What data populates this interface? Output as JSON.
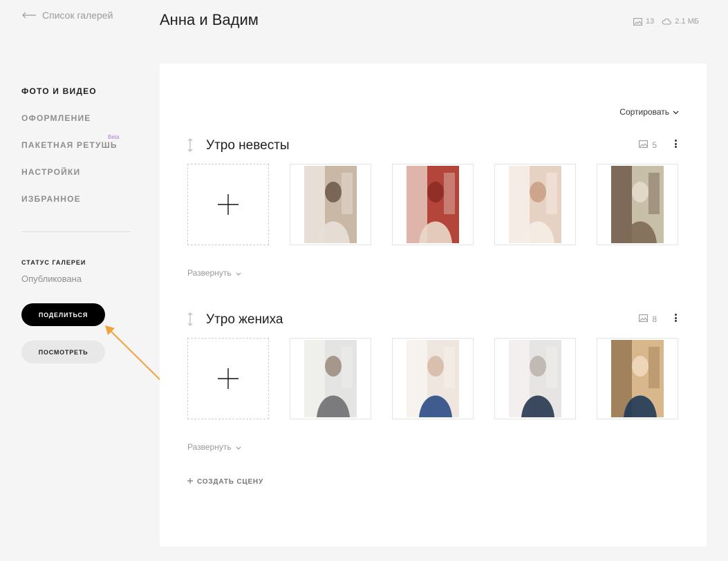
{
  "back_link": {
    "label": "Список галерей"
  },
  "page_title": "Анна и Вадим",
  "gallery_stats": {
    "photos": "13",
    "size": "2.1 МБ"
  },
  "sidebar": {
    "items": [
      {
        "label": "ФОТО И ВИДЕО",
        "active": true
      },
      {
        "label": "ОФОРМЛЕНИЕ",
        "active": false
      },
      {
        "label": "ПАКЕТНАЯ РЕТУШЬ",
        "active": false,
        "badge": "Beta"
      },
      {
        "label": "НАСТРОЙКИ",
        "active": false
      },
      {
        "label": "ИЗБРАННОЕ",
        "active": false
      }
    ],
    "status_label": "СТАТУС ГАЛЕРЕИ",
    "status_value": "Опубликована",
    "share_label": "ПОДЕЛИТЬСЯ",
    "view_label": "ПОСМОТРЕТЬ"
  },
  "main": {
    "sort_label": "Сортировать",
    "scenes": [
      {
        "title": "Утро невесты",
        "count": "5",
        "expand_label": "Развернуть",
        "photos": [
          {
            "icon": "photo-bride-mirror",
            "colors": [
              "#c9b8a6",
              "#e8e0d8",
              "#6b5748",
              "#f3efe9"
            ]
          },
          {
            "icon": "photo-red-shoes",
            "colors": [
              "#b4453a",
              "#e9d8c9",
              "#8a2a24",
              "#f1e6dc"
            ]
          },
          {
            "icon": "photo-dress-back",
            "colors": [
              "#e6d2c2",
              "#f5ede6",
              "#c79e83",
              "#fbf7f3"
            ]
          },
          {
            "icon": "photo-bride-smile",
            "colors": [
              "#c8bfa9",
              "#7e6a55",
              "#e7dccd",
              "#5c4636"
            ]
          }
        ]
      },
      {
        "title": "Утро жениха",
        "count": "8",
        "expand_label": "Развернуть",
        "photos": [
          {
            "icon": "photo-groom-vest",
            "colors": [
              "#e4e4e2",
              "#6f6f72",
              "#9a8a7c",
              "#f3f3f1"
            ]
          },
          {
            "icon": "photo-cufflinks",
            "colors": [
              "#efe6df",
              "#2c4c86",
              "#d5b9a6",
              "#faf6f2"
            ]
          },
          {
            "icon": "photo-groom-mirror",
            "colors": [
              "#e7e5e3",
              "#28374f",
              "#b9b2ab",
              "#f6f4f2"
            ]
          },
          {
            "icon": "photo-bedroom",
            "colors": [
              "#d9b78d",
              "#1f3a56",
              "#f0dcc0",
              "#8a6a48"
            ]
          }
        ]
      }
    ],
    "create_scene_label": "СОЗДАТЬ СЦЕНУ"
  },
  "accent_color": "#f0a33c"
}
